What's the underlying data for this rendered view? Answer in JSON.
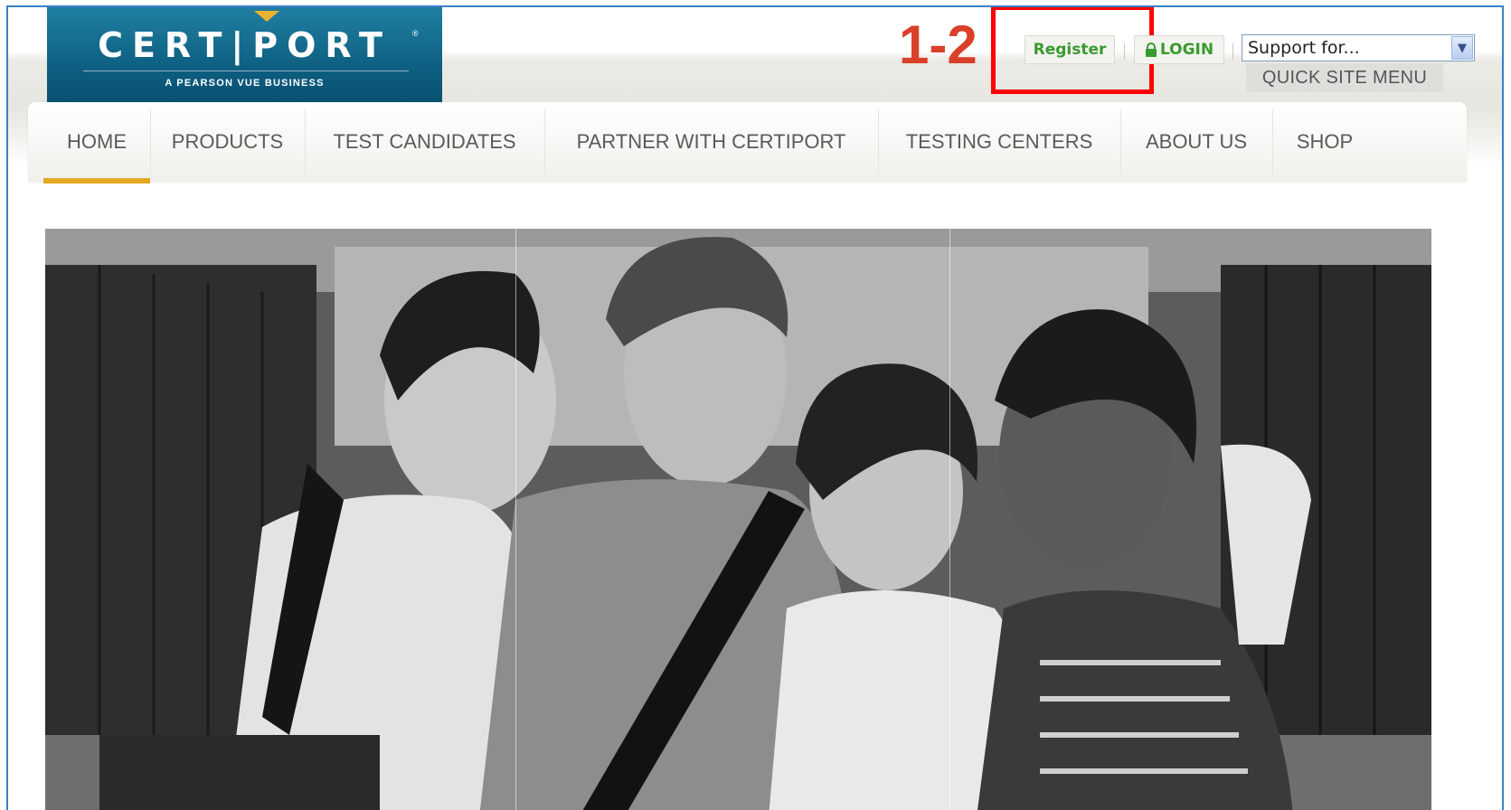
{
  "logo": {
    "wordmark": "CERT|PORT",
    "subtitle": "A PEARSON VUE BUSINESS",
    "registered_mark": "®",
    "colors": {
      "primary": "#0c5c7e",
      "accent": "#e8b430"
    }
  },
  "annotation": {
    "step_label": "1-2",
    "step_color": "#d9402a",
    "highlight_color": "#ff0000"
  },
  "header": {
    "register_label": "Register",
    "login_label": "LOGIN",
    "login_icon": "lock-icon",
    "support_select_value": "Support for...",
    "quick_menu_label": "QUICK SITE MENU",
    "link_color": "#3a9a2e"
  },
  "nav": {
    "items": [
      {
        "label": "HOME",
        "active": true
      },
      {
        "label": "PRODUCTS"
      },
      {
        "label": "TEST CANDIDATES"
      },
      {
        "label": "PARTNER WITH CERTIPORT"
      },
      {
        "label": "TESTING CENTERS"
      },
      {
        "label": "ABOUT US"
      },
      {
        "label": "SHOP"
      }
    ],
    "active_color": "#e5a823"
  },
  "hero": {
    "image_kind": "black-and-white photo of four smiling students in a school hallway with lockers"
  }
}
